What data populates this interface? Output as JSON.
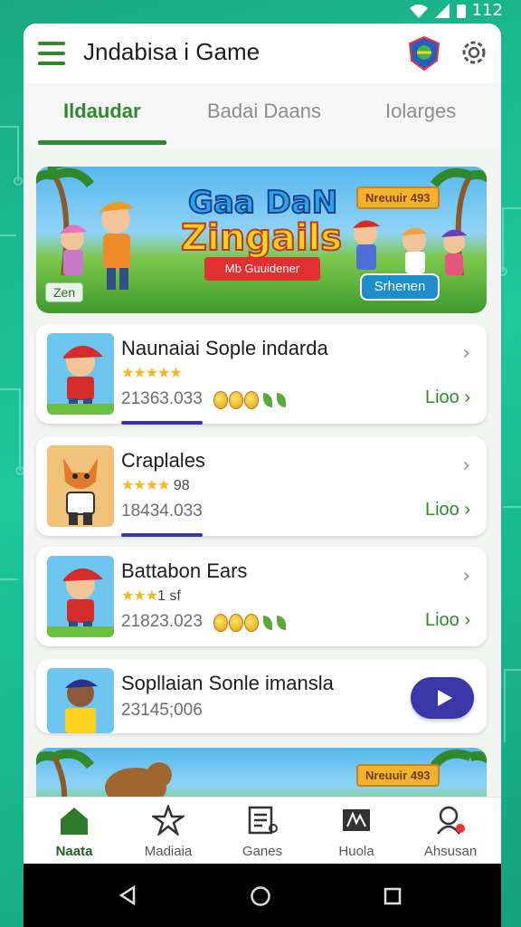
{
  "status": {
    "battery": "112"
  },
  "app": {
    "title": "Jndabisa i Game"
  },
  "tabs": [
    {
      "label": "Ildaudar",
      "active": true
    },
    {
      "label": "Badai Daans",
      "active": false
    },
    {
      "label": "Iolarges",
      "active": false
    }
  ],
  "banner": {
    "title_line1": "Gaa DaN",
    "title_line2": "Zingails",
    "ribbon": "Mb Guuidener",
    "badge": "Nreuuir 493",
    "button": "Srhenen",
    "corner": "Zen"
  },
  "games": [
    {
      "name": "Naunaiai Sople indarda",
      "stars": "★★★★★",
      "rating": "",
      "count": "21363.033",
      "action": "Lioo",
      "has_coins": true
    },
    {
      "name": "Craplales",
      "stars": "★★★★",
      "rating": "98",
      "count": "18434.033",
      "action": "Lioo",
      "has_coins": false
    },
    {
      "name": "Battabon Ears",
      "stars": "★★★",
      "rating": "1 sf",
      "count": "21823.023",
      "action": "Lioo",
      "has_coins": true
    },
    {
      "name": "Sopllaian Sonle imansla",
      "count": "23145;006"
    }
  ],
  "banner2": {
    "badge": "Nreuuir 493"
  },
  "nav": [
    {
      "label": "Naata",
      "icon": "home-icon",
      "active": true
    },
    {
      "label": "Madiaia",
      "icon": "star-icon",
      "active": false
    },
    {
      "label": "Ganes",
      "icon": "games-list-icon",
      "active": false
    },
    {
      "label": "Huola",
      "icon": "media-icon",
      "active": false
    },
    {
      "label": "Ahsusan",
      "icon": "profile-icon",
      "active": false
    }
  ],
  "colors": {
    "accent": "#2f8a2a",
    "play": "#3a35a8",
    "background": "#1fc79b"
  }
}
